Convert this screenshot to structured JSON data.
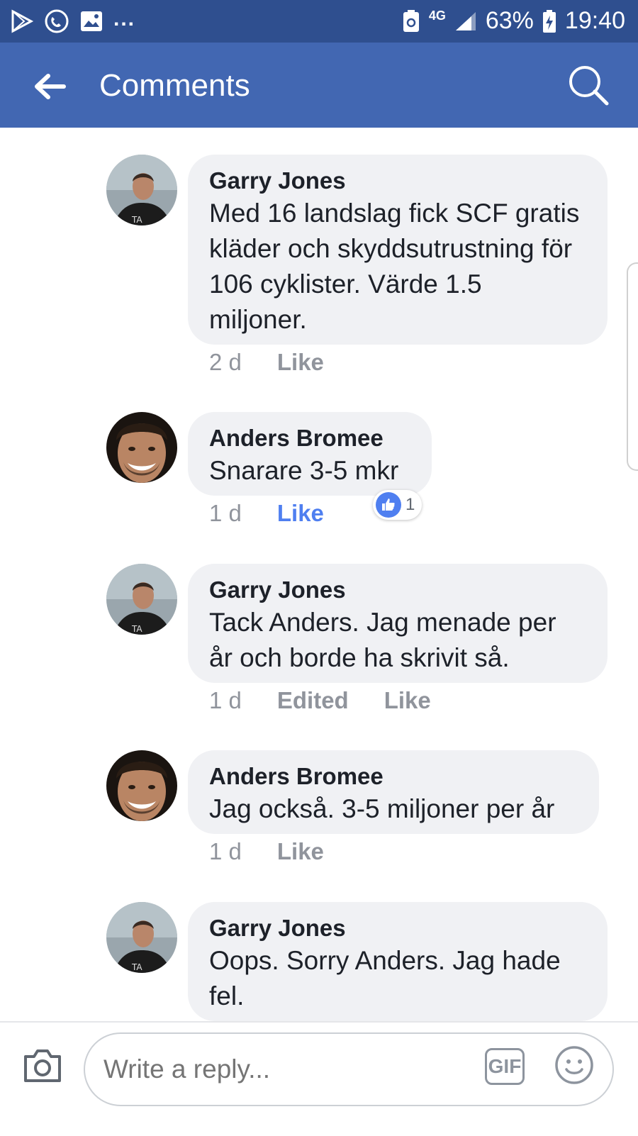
{
  "status_bar": {
    "battery": "63%",
    "time": "19:40",
    "network": "4G",
    "dots": "..."
  },
  "header": {
    "title": "Comments"
  },
  "comments": [
    {
      "author": "Garry Jones",
      "text": "Med 16 landslag fick SCF gratis kläder och skyddsutrustning för 106 cyklister. Värde 1.5 miljoner.",
      "time": "2 d",
      "like": "Like"
    },
    {
      "author": "Anders Bromee",
      "text": "Snarare 3-5 mkr",
      "time": "1 d",
      "like": "Like",
      "reaction_count": "1"
    },
    {
      "author": "Garry Jones",
      "text": "Tack Anders. Jag menade per år och borde ha skrivit så.",
      "time": "1 d",
      "edited": "Edited",
      "like": "Like"
    },
    {
      "author": "Anders Bromee",
      "text": "Jag också. 3-5 miljoner per år",
      "time": "1 d",
      "like": "Like"
    },
    {
      "author": "Garry Jones",
      "text": "Oops. Sorry Anders. Jag hade fel."
    }
  ],
  "composer": {
    "placeholder": "Write a reply...",
    "gif": "GIF"
  },
  "colors": {
    "brand": "#4267b2",
    "statusbar": "#2f4f8f",
    "like_active": "#4f7ff0",
    "bubble": "#f0f1f4"
  }
}
